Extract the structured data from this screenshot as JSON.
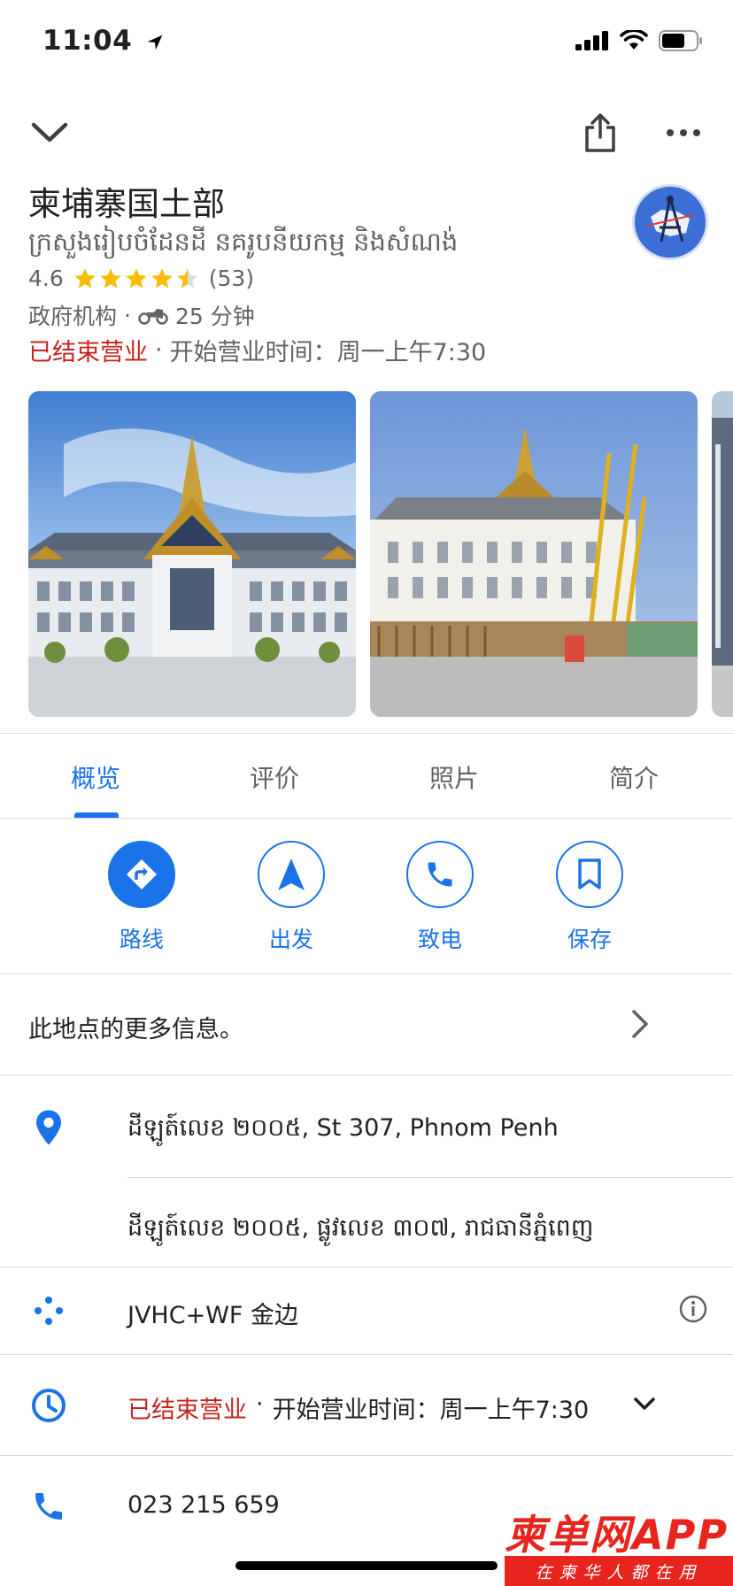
{
  "status_bar": {
    "time": "11:04"
  },
  "place": {
    "title": "柬埔寨国土部",
    "subtitle": "ក្រសួងរៀបចំដែនដី នគរូបនីយកម្ម និងសំណង់",
    "rating": "4.6",
    "stars": 4.5,
    "review_count": "(53)",
    "category": "政府机构",
    "travel_time": "25 分钟",
    "status_closed": "已结束营业",
    "opens_text": "开始营业时间：周一上午7:30"
  },
  "tabs": [
    {
      "label": "概览"
    },
    {
      "label": "评价"
    },
    {
      "label": "照片"
    },
    {
      "label": "简介"
    }
  ],
  "actions": [
    {
      "label": "路线",
      "icon": "directions-icon"
    },
    {
      "label": "出发",
      "icon": "navigation-arrow-icon"
    },
    {
      "label": "致电",
      "icon": "phone-icon"
    },
    {
      "label": "保存",
      "icon": "bookmark-icon"
    }
  ],
  "more_info": "此地点的更多信息。",
  "address": {
    "line1": "ដីឡូត៍លេខ ២០០៥, St 307, Phnom Penh",
    "line2": "ដីឡូត៍លេខ ២០០៥, ផ្លូវលេខ ៣០៧, រាជធានីភ្នំពេញ"
  },
  "plus_code": "JVHC+WF 金边",
  "hours": {
    "status": "已结束营业",
    "opens": "开始营业时间：周一上午7:30"
  },
  "phone": "023 215 659",
  "watermark": {
    "main": "柬单网APP",
    "sub": "在柬华人都在用"
  },
  "colors": {
    "accent": "#1a73e8",
    "closed": "#c5221f",
    "star": "#fbbc04",
    "watermark": "#e8241e"
  }
}
